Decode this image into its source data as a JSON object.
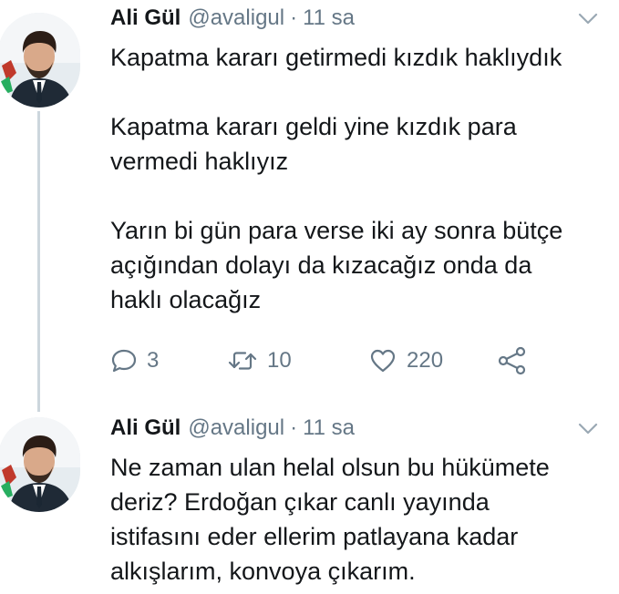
{
  "tweets": [
    {
      "author_name": "Ali Gül",
      "handle": "@avaligul",
      "separator": "·",
      "time": "11 sa",
      "paragraphs": [
        [
          "Kapatma kararı getirmedi kızdık haklıydık"
        ],
        [
          "Kapatma kararı geldi yine kızdık para",
          "vermedi haklıyız"
        ],
        [
          "Yarın bi gün para verse iki ay sonra bütçe",
          "açığından dolayı da kızacağız onda da",
          "haklı olacağız"
        ]
      ],
      "actions": {
        "reply_count": "3",
        "retweet_count": "10",
        "like_count": "220"
      }
    },
    {
      "author_name": "Ali Gül",
      "handle": "@avaligul",
      "separator": "·",
      "time": "11 sa",
      "lines": [
        "Ne zaman ulan helal olsun bu hükümete",
        "deriz? Erdoğan çıkar canlı yayında",
        "istifasını eder ellerim patlayana kadar",
        "alkışlarım, konvoya çıkarım."
      ]
    }
  ],
  "icons": {
    "caret": "chevron-down-icon",
    "reply": "speech-bubble-icon",
    "retweet": "retweet-arrows-icon",
    "like": "heart-icon",
    "share": "share-icon"
  },
  "colors": {
    "text": "#14171a",
    "secondary": "#657786",
    "thread_line": "#ccd6dd"
  }
}
